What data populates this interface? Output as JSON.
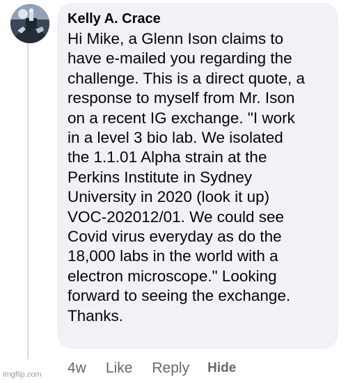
{
  "comment": {
    "author": "Kelly A. Crace",
    "lines": [
      "Hi Mike, a Glenn Ison claims to",
      "have e-mailed you regarding the",
      "challenge. This is a direct quote, a",
      "response to myself from Mr. Ison",
      "on a recent IG exchange. \"I work",
      "in a level 3 bio lab. We isolated",
      "the 1.1.01 Alpha strain at the",
      "Perkins Institute in Sydney",
      "University in 2020 (look it up)",
      "VOC-202012/01. We could see",
      "Covid virus everyday as do the",
      "18,000 labs in the world with a",
      "electron microscope.\" Looking",
      "forward to seeing the exchange.",
      "Thanks."
    ]
  },
  "actions": {
    "time": "4w",
    "like": "Like",
    "reply": "Reply",
    "hide": "Hide"
  },
  "watermark": "imgflip.com",
  "colors": {
    "bubble": "#f0f2f5",
    "text": "#050505",
    "meta": "#65676b"
  }
}
